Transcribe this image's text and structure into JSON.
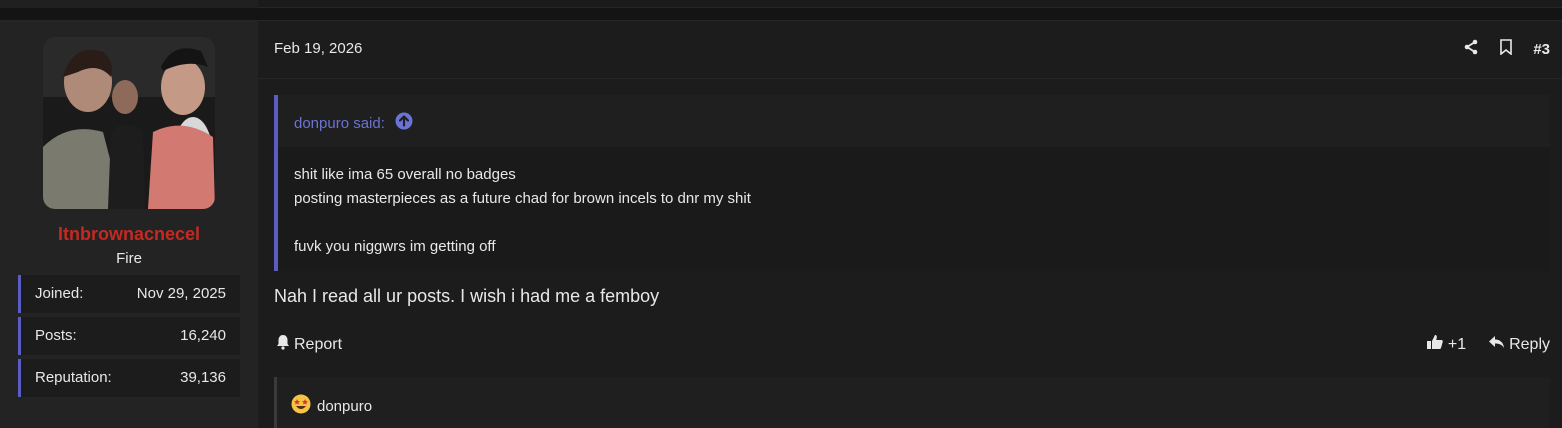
{
  "user": {
    "username": "Itnbrownacnecel",
    "title": "Fire",
    "stats": [
      {
        "label": "Joined:",
        "value": "Nov 29, 2025"
      },
      {
        "label": "Posts:",
        "value": "16,240"
      },
      {
        "label": "Reputation:",
        "value": "39,136"
      }
    ]
  },
  "post": {
    "date": "Feb 19, 2026",
    "number": "#3",
    "quote": {
      "author": "donpuro said:",
      "lines": [
        "shit like ima 65 overall no badges",
        "posting masterpieces as a future chad for brown incels to dnr my shit",
        "",
        "fuvk you niggwrs im getting off"
      ]
    },
    "message": "Nah I read all ur posts. I wish i had me a femboy",
    "actions": {
      "report": "Report",
      "like_count": "+1",
      "reply": "Reply"
    },
    "reactions": {
      "user": "donpuro",
      "icon": "star-struck-emoji-icon"
    }
  },
  "colors": {
    "accent": "#5a5ec4",
    "username": "#c42a22",
    "quote_author": "#6b73d6"
  }
}
